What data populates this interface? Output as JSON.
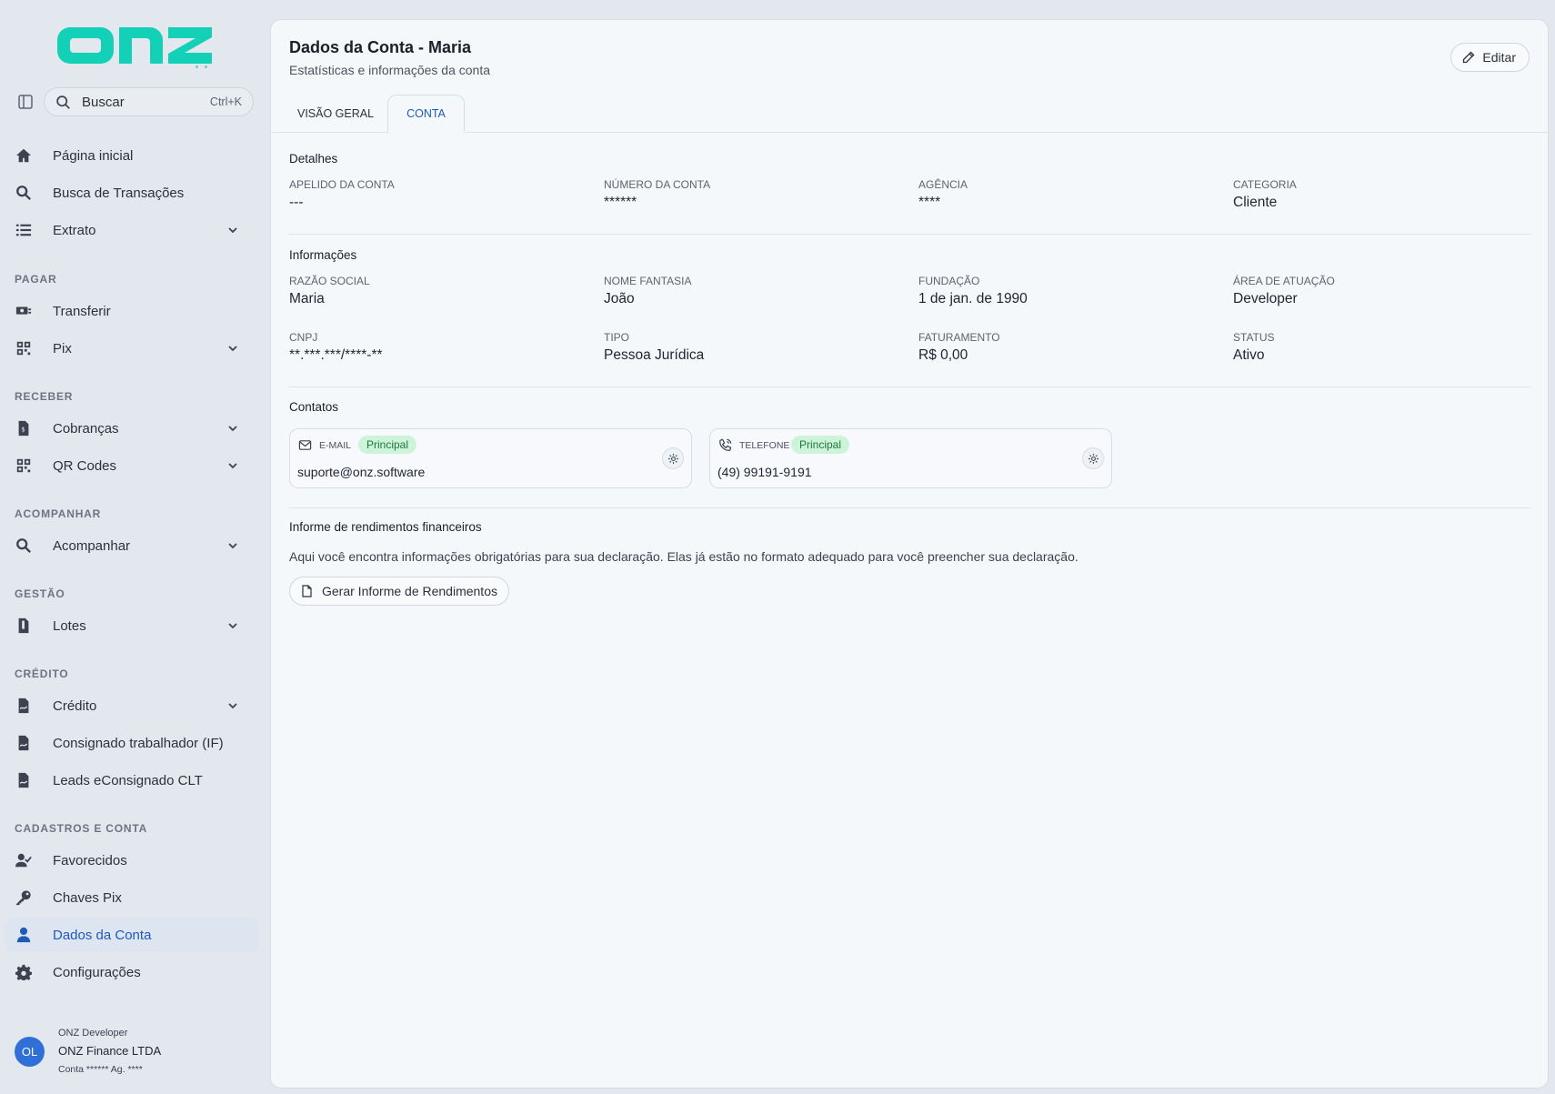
{
  "brand": {
    "logo_text": "onz",
    "accent": "#12d1b7"
  },
  "search": {
    "placeholder": "Buscar",
    "shortcut": "Ctrl+K"
  },
  "sidebar": {
    "top_items": [
      {
        "label": "Página inicial",
        "icon": "home-icon"
      },
      {
        "label": "Busca de Transações",
        "icon": "search-icon"
      },
      {
        "label": "Extrato",
        "icon": "list-icon"
      }
    ],
    "sections": {
      "pagar": "PAGAR",
      "receber": "RECEBER",
      "acompanhar": "ACOMPANHAR",
      "gestao": "GESTÃO",
      "credito": "CRÉDITO",
      "cadastros": "CADASTROS E CONTA"
    },
    "pagar_items": [
      {
        "label": "Transferir",
        "icon": "money-transfer-icon"
      },
      {
        "label": "Pix",
        "icon": "qr-grid-icon"
      }
    ],
    "receber_items": [
      {
        "label": "Cobranças",
        "icon": "invoice-icon"
      },
      {
        "label": "QR Codes",
        "icon": "qr-grid-icon"
      }
    ],
    "acompanhar_items": [
      {
        "label": "Acompanhar",
        "icon": "search-icon"
      }
    ],
    "gestao_items": [
      {
        "label": "Lotes",
        "icon": "batch-file-icon"
      }
    ],
    "credito_items": [
      {
        "label": "Crédito",
        "icon": "credit-file-icon"
      },
      {
        "label": "Consignado trabalhador (IF)",
        "icon": "credit-file-icon"
      },
      {
        "label": "Leads eConsignado CLT",
        "icon": "credit-file-icon"
      }
    ],
    "cadastros_items": [
      {
        "label": "Favorecidos",
        "icon": "user-check-icon"
      },
      {
        "label": "Chaves Pix",
        "icon": "key-icon"
      },
      {
        "label": "Dados da Conta",
        "icon": "user-icon"
      },
      {
        "label": "Configurações",
        "icon": "gear-icon"
      }
    ],
    "active_color": "#1f5ab8"
  },
  "user": {
    "initials": "OL",
    "role": "ONZ Developer",
    "company": "ONZ Finance LTDA",
    "account": "Conta ****** Ag. ****"
  },
  "header": {
    "title": "Dados da Conta - Maria",
    "subtitle": "Estatísticas e informações da conta",
    "edit_label": "Editar"
  },
  "tabs": [
    {
      "label": "VISÃO GERAL",
      "active": false
    },
    {
      "label": "CONTA",
      "active": true
    }
  ],
  "detalhes": {
    "heading": "Detalhes",
    "fields": [
      {
        "label": "APELIDO DA CONTA",
        "value": "---"
      },
      {
        "label": "NÚMERO DA CONTA",
        "value": "******"
      },
      {
        "label": "AGÊNCIA",
        "value": "****"
      },
      {
        "label": "CATEGORIA",
        "value": "Cliente"
      }
    ]
  },
  "informacoes": {
    "heading": "Informações",
    "fields": [
      {
        "label": "RAZÃO SOCIAL",
        "value": "Maria"
      },
      {
        "label": "NOME FANTASIA",
        "value": "João"
      },
      {
        "label": "FUNDAÇÃO",
        "value": "1 de jan. de 1990"
      },
      {
        "label": "ÁREA DE ATUAÇÃO",
        "value": "Developer"
      },
      {
        "label": "CNPJ",
        "value": "**.***.***/****-**"
      },
      {
        "label": "TIPO",
        "value": "Pessoa Jurídica"
      },
      {
        "label": "FATURAMENTO",
        "value": "R$ 0,00"
      },
      {
        "label": "STATUS",
        "value": "Ativo"
      }
    ]
  },
  "contatos": {
    "heading": "Contatos",
    "items": [
      {
        "type": "E-MAIL",
        "badge": "Principal",
        "value": "suporte@onz.software",
        "icon": "mail-icon"
      },
      {
        "type": "TELEFONE",
        "badge": "Principal",
        "value": "(49) 99191-9191",
        "icon": "phone-icon"
      }
    ],
    "badge_color": "#cdf3d9"
  },
  "informe": {
    "heading": "Informe de rendimentos financeiros",
    "text": "Aqui você encontra informações obrigatórias para sua declaração. Elas já estão no formato adequado para você preencher sua declaração.",
    "button_label": "Gerar Informe de Rendimentos"
  }
}
